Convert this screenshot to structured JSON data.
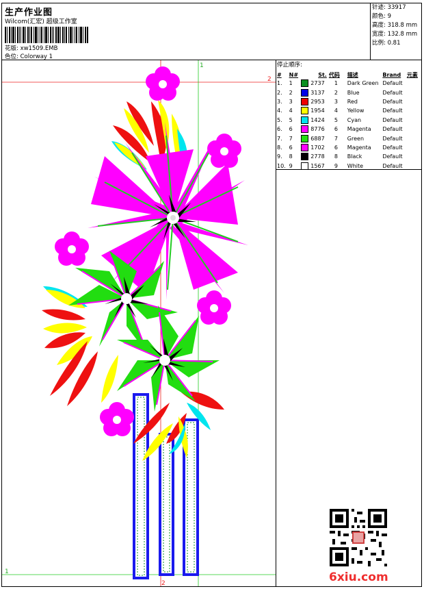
{
  "header": {
    "title": "生产作业图",
    "subtitle": "Wilcom(汇宏) 超级工作室",
    "design_label": "花版:",
    "design_file": "xw1509.EMB",
    "colorway_label": "色位:",
    "colorway": "Colorway 1"
  },
  "stats": {
    "stitches": "针迹: 33917",
    "colors": "颜色: 9",
    "height": "高度: 318.8 mm",
    "width": "宽度: 132.8 mm",
    "ratio": "比例: 0.81"
  },
  "sequence": {
    "title": "停止顺序:",
    "headers": [
      "#",
      "N#",
      "St.",
      "代码",
      "描述",
      "Brand",
      "元素"
    ],
    "rows": [
      {
        "idx": "1.",
        "n": "1",
        "color": "#0a8f1f",
        "st": "2737",
        "code": "1",
        "desc": "Dark Green",
        "brand": "Default"
      },
      {
        "idx": "2.",
        "n": "2",
        "color": "#0000e6",
        "st": "3137",
        "code": "2",
        "desc": "Blue",
        "brand": "Default"
      },
      {
        "idx": "3.",
        "n": "3",
        "color": "#ee0000",
        "st": "2953",
        "code": "3",
        "desc": "Red",
        "brand": "Default"
      },
      {
        "idx": "4.",
        "n": "4",
        "color": "#ffff00",
        "st": "1954",
        "code": "4",
        "desc": "Yellow",
        "brand": "Default"
      },
      {
        "idx": "5.",
        "n": "5",
        "color": "#00e5ee",
        "st": "1424",
        "code": "5",
        "desc": "Cyan",
        "brand": "Default"
      },
      {
        "idx": "6.",
        "n": "6",
        "color": "#ff00ff",
        "st": "8776",
        "code": "6",
        "desc": "Magenta",
        "brand": "Default"
      },
      {
        "idx": "7.",
        "n": "7",
        "color": "#22dd11",
        "st": "6887",
        "code": "7",
        "desc": "Green",
        "brand": "Default"
      },
      {
        "idx": "8.",
        "n": "6",
        "color": "#ff00ff",
        "st": "1702",
        "code": "6",
        "desc": "Magenta",
        "brand": "Default"
      },
      {
        "idx": "9.",
        "n": "8",
        "color": "#000000",
        "st": "2778",
        "code": "8",
        "desc": "Black",
        "brand": "Default"
      },
      {
        "idx": "10.",
        "n": "9",
        "color": "#ffffff",
        "st": "1567",
        "code": "9",
        "desc": "White",
        "brand": "Default"
      }
    ]
  },
  "guides": {
    "h_top": "2",
    "h_bottom": "1",
    "v_top": "1",
    "v_bottom": "2"
  },
  "logo": "6xiu.com"
}
